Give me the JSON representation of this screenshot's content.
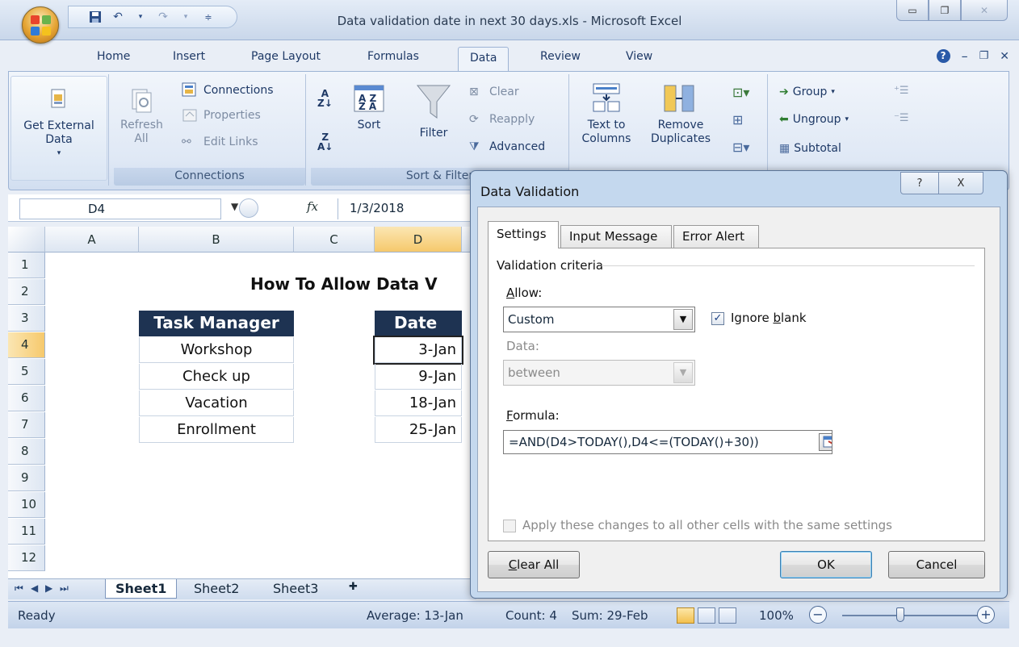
{
  "window": {
    "title": "Data validation date in next 30 days.xls - Microsoft Excel"
  },
  "ribbon_tabs": [
    "Home",
    "Insert",
    "Page Layout",
    "Formulas",
    "Data",
    "Review",
    "View"
  ],
  "ribbon": {
    "get_external_data": "Get External Data",
    "refresh_all": "Refresh All",
    "connections": "Connections",
    "properties": "Properties",
    "edit_links": "Edit Links",
    "connections_group": "Connections",
    "sort_group": "Sort & Filter",
    "sort": "Sort",
    "filter": "Filter",
    "clear": "Clear",
    "reapply": "Reapply",
    "advanced": "Advanced",
    "text_to_columns": "Text to Columns",
    "remove_duplicates": "Remove Duplicates",
    "group": "Group",
    "ungroup": "Ungroup",
    "subtotal": "Subtotal"
  },
  "formula_bar": {
    "cell_ref": "D4",
    "fx": "fx",
    "value": "1/3/2018"
  },
  "grid": {
    "columns": [
      "A",
      "B",
      "C",
      "D"
    ],
    "rows": [
      "1",
      "2",
      "3",
      "4",
      "5",
      "6",
      "7",
      "8",
      "9",
      "10",
      "11",
      "12"
    ],
    "title": "How To Allow Data V",
    "task_header": "Task Manager",
    "date_header": "Date",
    "tasks": [
      "Workshop",
      "Check up",
      "Vacation",
      "Enrollment"
    ],
    "dates": [
      "3-Jan",
      "9-Jan",
      "18-Jan",
      "25-Jan"
    ]
  },
  "sheet_tabs": [
    "Sheet1",
    "Sheet2",
    "Sheet3"
  ],
  "status_bar": {
    "ready": "Ready",
    "average": "Average: 13-Jan",
    "count": "Count: 4",
    "sum": "Sum: 29-Feb",
    "zoom": "100%",
    "zoom_level_percent": 100
  },
  "dialog": {
    "title": "Data Validation",
    "help_glyph": "?",
    "close_glyph": "X",
    "tabs": [
      "Settings",
      "Input Message",
      "Error Alert"
    ],
    "active_tab": "Settings",
    "criteria_label": "Validation criteria",
    "allow_label": "Allow:",
    "allow_value": "Custom",
    "ignore_blank": "Ignore blank",
    "ignore_blank_checked": true,
    "data_label": "Data:",
    "data_value": "between",
    "formula_label": "Formula:",
    "formula_value": "=AND(D4>TODAY(),D4<=(TODAY()+30))",
    "apply_all": "Apply these changes to all other cells with the same settings",
    "apply_all_checked": false,
    "clear_all": "Clear All",
    "ok": "OK",
    "cancel": "Cancel"
  }
}
